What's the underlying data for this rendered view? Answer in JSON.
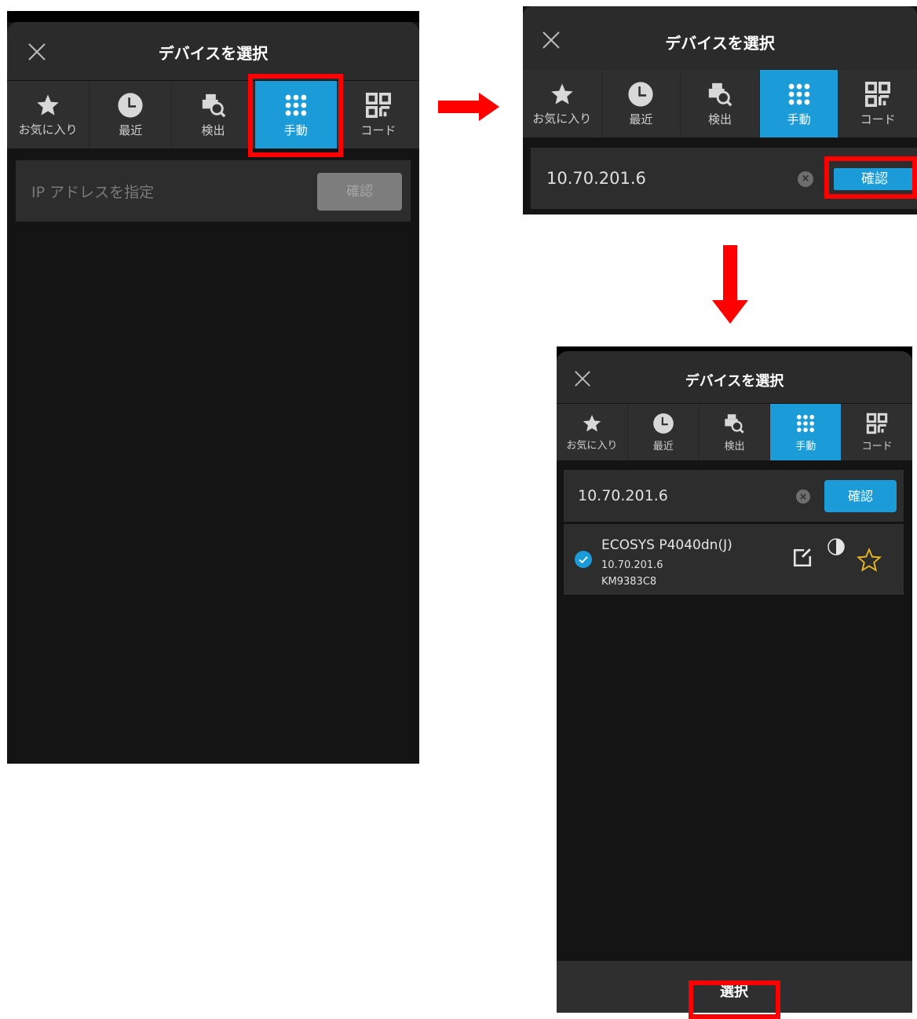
{
  "dialog": {
    "title": "デバイスを選択",
    "tabs": [
      {
        "label": "お気に入り",
        "icon": "star-icon"
      },
      {
        "label": "最近",
        "icon": "clock-icon"
      },
      {
        "label": "検出",
        "icon": "printer-search-icon"
      },
      {
        "label": "手動",
        "icon": "keypad-icon"
      },
      {
        "label": "コード",
        "icon": "qr-code-icon"
      }
    ],
    "active_tab": "手動",
    "confirm_label": "確認",
    "select_label": "選択"
  },
  "step1": {
    "ip_placeholder": "IP アドレスを指定",
    "ip_value": ""
  },
  "step2": {
    "ip_value": "10.70.201.6"
  },
  "step3": {
    "ip_value": "10.70.201.6",
    "device": {
      "model": "ECOSYS P4040dn(J)",
      "ip": "10.70.201.6",
      "host": "KM9383C8",
      "selected": true,
      "color_mode": "monochrome"
    }
  },
  "colors": {
    "accent": "#1b9cd8",
    "highlight": "#ff0000",
    "favorite_star": "#e8b820"
  }
}
